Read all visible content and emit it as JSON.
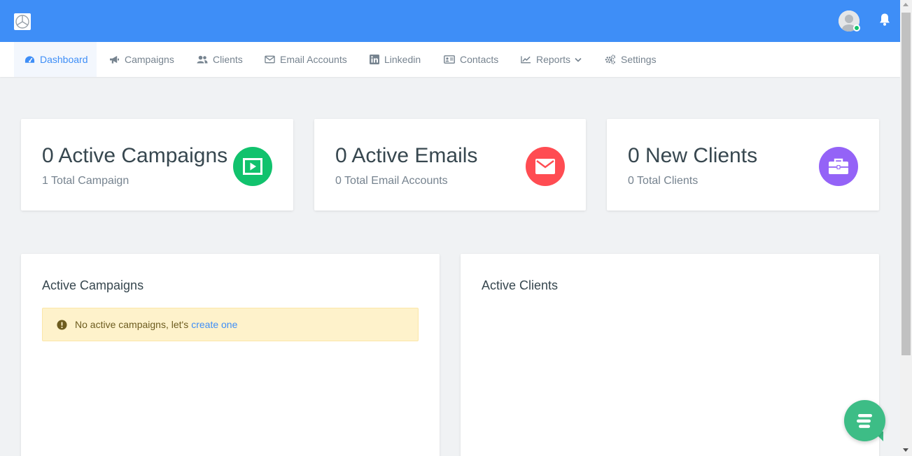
{
  "nav": {
    "items": [
      {
        "label": "Dashboard",
        "icon": "dashboard-icon",
        "active": true
      },
      {
        "label": "Campaigns",
        "icon": "bullhorn-icon"
      },
      {
        "label": "Clients",
        "icon": "users-icon"
      },
      {
        "label": "Email Accounts",
        "icon": "envelope-icon"
      },
      {
        "label": "Linkedin",
        "icon": "linkedin-icon"
      },
      {
        "label": "Contacts",
        "icon": "address-card-icon"
      },
      {
        "label": "Reports",
        "icon": "line-chart-icon"
      },
      {
        "label": "Settings",
        "icon": "cogs-icon"
      }
    ]
  },
  "stats": [
    {
      "title": "0 Active Campaigns",
      "subtitle": "1 Total Campaign",
      "icon": "play-icon",
      "color": "#11c26d"
    },
    {
      "title": "0 Active Emails",
      "subtitle": "0 Total Email Accounts",
      "icon": "envelope-icon",
      "color": "#ff4c52"
    },
    {
      "title": "0 New Clients",
      "subtitle": "0 Total Clients",
      "icon": "briefcase-icon",
      "color": "#9463f7"
    }
  ],
  "panels": {
    "campaigns": {
      "title": "Active Campaigns",
      "alert_text": "No active campaigns, let's",
      "alert_link": "create one"
    },
    "clients": {
      "title": "Active Clients"
    }
  },
  "colors": {
    "accent": "#3e8ef7",
    "background": "#f0f2f4",
    "chat": "#3dbd86"
  }
}
